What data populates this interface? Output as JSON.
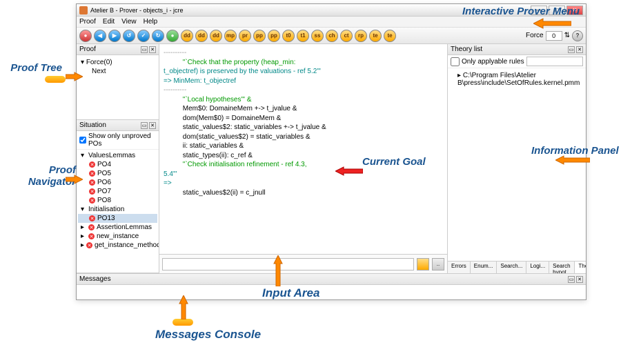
{
  "window": {
    "title": "Atelier B - Prover - objects_i - jcre"
  },
  "menu": [
    "Proof",
    "Edit",
    "View",
    "Help"
  ],
  "toolbar": {
    "buttons": [
      {
        "cls": "red",
        "t": "●"
      },
      {
        "cls": "blue",
        "t": "◀"
      },
      {
        "cls": "blue",
        "t": "▶"
      },
      {
        "cls": "blue",
        "t": "↺"
      },
      {
        "cls": "blue",
        "t": "✓"
      },
      {
        "cls": "blue",
        "t": "↻"
      },
      {
        "cls": "green",
        "t": "●"
      },
      {
        "cls": "orange",
        "t": "dd"
      },
      {
        "cls": "orange",
        "t": "dd"
      },
      {
        "cls": "orange",
        "t": "dd"
      },
      {
        "cls": "orange",
        "t": "mp"
      },
      {
        "cls": "orange",
        "t": "pr"
      },
      {
        "cls": "orange",
        "t": "pp"
      },
      {
        "cls": "orange",
        "t": "pp"
      },
      {
        "cls": "orange",
        "t": "t0"
      },
      {
        "cls": "orange",
        "t": "t1"
      },
      {
        "cls": "orange",
        "t": "ss"
      },
      {
        "cls": "orange",
        "t": "ch"
      },
      {
        "cls": "orange",
        "t": "ct"
      },
      {
        "cls": "orange",
        "t": "rp"
      },
      {
        "cls": "orange",
        "t": "te"
      },
      {
        "cls": "orange",
        "t": "te"
      }
    ],
    "force_label": "Force",
    "force_value": "0",
    "help": "?"
  },
  "proof_panel": {
    "title": "Proof",
    "items": [
      "Force(0)",
      "Next"
    ]
  },
  "situation_panel": {
    "title": "Situation",
    "filter": "Show only unproved POs",
    "tree": [
      {
        "lv": 1,
        "exp": "▾",
        "label": "ValuesLemmas"
      },
      {
        "lv": 2,
        "ic": 1,
        "label": "PO4"
      },
      {
        "lv": 2,
        "ic": 1,
        "label": "PO5"
      },
      {
        "lv": 2,
        "ic": 1,
        "label": "PO6"
      },
      {
        "lv": 2,
        "ic": 1,
        "label": "PO7"
      },
      {
        "lv": 2,
        "ic": 1,
        "label": "PO8"
      },
      {
        "lv": 1,
        "exp": "▾",
        "label": "Initialisation"
      },
      {
        "lv": 2,
        "ic": 1,
        "label": "PO13",
        "sel": true
      },
      {
        "lv": 1,
        "exp": "▸",
        "ic": 1,
        "label": "AssertionLemmas"
      },
      {
        "lv": 1,
        "exp": "▸",
        "ic": 1,
        "label": "new_instance"
      },
      {
        "lv": 1,
        "exp": "▸",
        "ic": 1,
        "label": "get_instance_method"
      }
    ]
  },
  "goal": {
    "lines": [
      {
        "c": "gray",
        "t": "----------"
      },
      {
        "c": "green",
        "t": "          \"`Check that the property (heap_min:"
      },
      {
        "c": "teal",
        "t": "t_objectref) is preserved by the valuations - ref 5.2'\""
      },
      {
        "c": "teal",
        "t": "=> MinMem: t_objectref"
      },
      {
        "c": "gray",
        "t": "----------"
      },
      {
        "c": "green",
        "t": "          \"`Local hypotheses'\" &"
      },
      {
        "c": "black",
        "t": "          Mem$0: DomaineMem +-> t_jvalue &"
      },
      {
        "c": "black",
        "t": "          dom(Mem$0) = DomaineMem &"
      },
      {
        "c": "black",
        "t": "          static_values$2: static_variables +-> t_jvalue &"
      },
      {
        "c": "black",
        "t": "          dom(static_values$2) = static_variables &"
      },
      {
        "c": "black",
        "t": "          ii: static_variables &"
      },
      {
        "c": "black",
        "t": "          static_types(ii): c_ref &"
      },
      {
        "c": "green",
        "t": "          \"`Check initialisation refinement - ref 4.3,"
      },
      {
        "c": "teal",
        "t": "5.4'\""
      },
      {
        "c": "teal",
        "t": "=>"
      },
      {
        "c": "black",
        "t": "          static_values$2(ii) = c_jnull"
      }
    ]
  },
  "theory_panel": {
    "title": "Theory list",
    "filter": "Only applyable rules",
    "rules": [
      "C:\\Program Files\\Atelier B\\press\\include\\SetOfRules.kernel.pmm"
    ],
    "tabs": [
      "Errors",
      "Enum...",
      "Search...",
      "Logi...",
      "Search hypot...",
      "Theo..."
    ]
  },
  "messages": {
    "title": "Messages"
  },
  "annotations": {
    "prover_menu": "Interactive Prover Menu",
    "proof_tree": "Proof Tree",
    "proof_nav": "Proof Navigator",
    "current_goal": "Current Goal",
    "info_panel": "Information Panel",
    "input_area": "Input Area",
    "messages_console": "Messages Console"
  }
}
